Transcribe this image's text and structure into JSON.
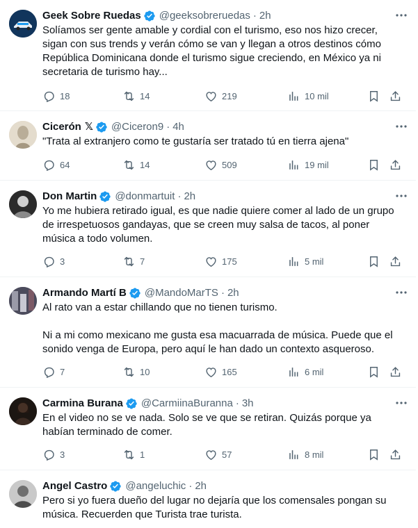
{
  "tweets": [
    {
      "name": "Geek Sobre Ruedas",
      "handle": "@geeksobreruedas",
      "dot": "·",
      "time": "2h",
      "text": "Solíamos ser gente amable y cordial con el turismo, eso nos hizo crecer,\nsigan con sus trends y verán cómo se van y llegan a otros destinos cómo\nRepública Dominicana donde el turismo sigue creciendo, en México ya ni\nsecretaria de turismo hay...",
      "replies": "18",
      "retweets": "14",
      "likes": "219",
      "views": "10 mil"
    },
    {
      "name": "Cicerón",
      "handle": "@Ciceron9",
      "dot": "·",
      "time": "4h",
      "text": "\"Trata al extranjero como te gustaría ser tratado tú en tierra ajena\"",
      "replies": "64",
      "retweets": "14",
      "likes": "509",
      "views": "19 mil"
    },
    {
      "name": "Don Martin",
      "handle": "@donmartuit",
      "dot": "·",
      "time": "2h",
      "text": "Yo me hubiera retirado igual, es que nadie quiere comer al lado de un grupo\nde irrespetuosos gandayas, que se creen muy salsa de tacos, al poner\nmúsica a todo volumen.",
      "replies": "3",
      "retweets": "7",
      "likes": "175",
      "views": "5 mil"
    },
    {
      "name": "Armando Martí B",
      "handle": "@MandoMarTS",
      "dot": "·",
      "time": "2h",
      "text": "Al rato van a estar chillando que no tienen turismo.\n\nNi a mi como mexicano me gusta esa macuarrada de música. Puede que el\nsonido venga de Europa, pero aquí le han dado un contexto asqueroso.",
      "replies": "7",
      "retweets": "10",
      "likes": "165",
      "views": "6 mil"
    },
    {
      "name": "Carmina Burana",
      "handle": "@CarmiinaBuranna",
      "dot": "·",
      "time": "3h",
      "text": "En el video no se ve nada. Solo se ve que se retiran. Quizás porque ya\nhabían terminado de comer.",
      "replies": "3",
      "retweets": "1",
      "likes": "57",
      "views": "8 mil"
    },
    {
      "name": "Angel Castro",
      "handle": "@angeluchic",
      "dot": "·",
      "time": "2h",
      "text": "Pero si yo fuera dueño del lugar no dejaría que los comensales pongan su\nmúsica. Recuerden que Turista trae turista."
    }
  ],
  "icons": {
    "verified_color": "#1d9bf0",
    "action_color": "#536471",
    "more": "more-icon",
    "reply": "reply-icon",
    "retweet": "retweet-icon",
    "like": "heart-icon",
    "views": "views-icon",
    "bookmark": "bookmark-icon",
    "share": "share-icon"
  }
}
